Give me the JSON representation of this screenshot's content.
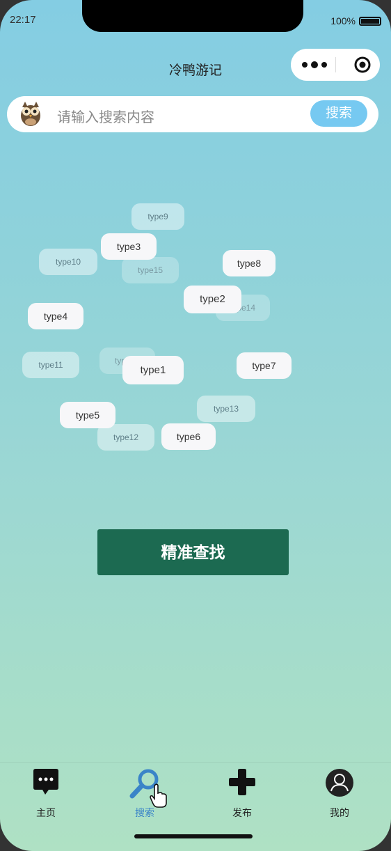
{
  "status": {
    "time": "22:17",
    "battery": "100%"
  },
  "nav": {
    "title": "冷鸭游记"
  },
  "search": {
    "placeholder": "请输入搜索内容",
    "button_label": "搜索"
  },
  "tags": [
    {
      "label": "type9",
      "style": "mid"
    },
    {
      "label": "type3",
      "style": "strong"
    },
    {
      "label": "type10",
      "style": "mid"
    },
    {
      "label": "type15",
      "style": "faint"
    },
    {
      "label": "type8",
      "style": "strong"
    },
    {
      "label": "type14",
      "style": "faint"
    },
    {
      "label": "type2",
      "style": "strong"
    },
    {
      "label": "type4",
      "style": "strong"
    },
    {
      "label": "type11",
      "style": "mid"
    },
    {
      "label": "type16",
      "style": "faint"
    },
    {
      "label": "type1",
      "style": "strong"
    },
    {
      "label": "type7",
      "style": "strong"
    },
    {
      "label": "type13",
      "style": "mid"
    },
    {
      "label": "type5",
      "style": "strong"
    },
    {
      "label": "type12",
      "style": "mid"
    },
    {
      "label": "type6",
      "style": "strong"
    }
  ],
  "precise_search": {
    "label": "精准查找"
  },
  "tabbar": {
    "items": [
      {
        "label": "主页",
        "icon": "chat-bubble-icon",
        "active": false
      },
      {
        "label": "搜索",
        "icon": "search-icon",
        "active": true
      },
      {
        "label": "发布",
        "icon": "plus-icon",
        "active": false
      },
      {
        "label": "我的",
        "icon": "user-avatar-icon",
        "active": false
      }
    ]
  },
  "colors": {
    "accent_green": "#1c6a51",
    "search_button": "#76c9f1",
    "active_tab": "#3a84c8"
  }
}
